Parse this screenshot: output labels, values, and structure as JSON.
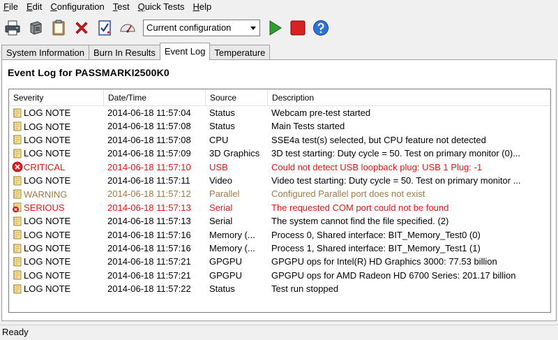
{
  "menu": [
    {
      "label": "File",
      "mnemonic": "F",
      "rest": "ile"
    },
    {
      "label": "Edit",
      "mnemonic": "E",
      "rest": "dit"
    },
    {
      "label": "Configuration",
      "mnemonic": "C",
      "rest": "onfiguration"
    },
    {
      "label": "Test",
      "mnemonic": "T",
      "rest": "est"
    },
    {
      "label": "Quick Tests",
      "mnemonic": "Q",
      "rest": "uick Tests"
    },
    {
      "label": "Help",
      "mnemonic": "H",
      "rest": "elp"
    }
  ],
  "toolbar": {
    "buttons": [
      {
        "icon": "printer-icon"
      },
      {
        "icon": "device-icon"
      },
      {
        "icon": "clipboard-icon"
      },
      {
        "icon": "delete-x-icon"
      },
      {
        "icon": "checklist-icon"
      },
      {
        "icon": "speedometer-icon"
      }
    ],
    "config_select_value": "Current configuration",
    "run_icon": "play-icon",
    "stop_icon": "stop-icon",
    "help_icon": "help-icon"
  },
  "tabs": [
    {
      "label": "System Information",
      "active": false
    },
    {
      "label": "Burn In Results",
      "active": false
    },
    {
      "label": "Event Log",
      "active": true
    },
    {
      "label": "Temperature",
      "active": false
    }
  ],
  "panel": {
    "title": "Event Log for PASSMARKI2500K0"
  },
  "log": {
    "columns": [
      "Severity",
      "Date/Time",
      "Source",
      "Description"
    ],
    "severity_colors": {
      "LOG NOTE": "#000000",
      "CRITICAL": "#e81414",
      "WARNING": "#a07a46",
      "SERIOUS": "#e81414"
    },
    "rows": [
      {
        "severity": "LOG NOTE",
        "datetime": "2014-06-18 11:57:04",
        "source": "Status",
        "description": "Webcam pre-test started"
      },
      {
        "severity": "LOG NOTE",
        "datetime": "2014-06-18 11:57:08",
        "source": "Status",
        "description": "Main Tests started"
      },
      {
        "severity": "LOG NOTE",
        "datetime": "2014-06-18 11:57:08",
        "source": "CPU",
        "description": "SSE4a test(s) selected, but CPU feature not detected"
      },
      {
        "severity": "LOG NOTE",
        "datetime": "2014-06-18 11:57:09",
        "source": "3D Graphics",
        "description": "3D test starting: Duty cycle = 50. Test on primary monitor (0)..."
      },
      {
        "severity": "CRITICAL",
        "datetime": "2014-06-18 11:57:10",
        "source": "USB",
        "description": "Could not detect USB loopback plug: USB 1 Plug: -1"
      },
      {
        "severity": "LOG NOTE",
        "datetime": "2014-06-18 11:57:11",
        "source": "Video",
        "description": "Video test starting: Duty cycle = 50. Test on primary monitor ..."
      },
      {
        "severity": "WARNING",
        "datetime": "2014-06-18 11:57:12",
        "source": "Parallel",
        "description": "Configured Parallel port does not exist"
      },
      {
        "severity": "SERIOUS",
        "datetime": "2014-06-18 11:57:13",
        "source": "Serial",
        "description": "The requested COM port could not be found"
      },
      {
        "severity": "LOG NOTE",
        "datetime": "2014-06-18 11:57:13",
        "source": "Serial",
        "description": "The system cannot find the file specified.   (2)"
      },
      {
        "severity": "LOG NOTE",
        "datetime": "2014-06-18 11:57:16",
        "source": "Memory (...",
        "description": "Process 0, Shared interface: BIT_Memory_Test0 (0)"
      },
      {
        "severity": "LOG NOTE",
        "datetime": "2014-06-18 11:57:16",
        "source": "Memory (...",
        "description": "Process 1, Shared interface: BIT_Memory_Test1 (1)"
      },
      {
        "severity": "LOG NOTE",
        "datetime": "2014-06-18 11:57:21",
        "source": "GPGPU",
        "description": "GPGPU ops for Intel(R) HD Graphics 3000: 77.53 billion"
      },
      {
        "severity": "LOG NOTE",
        "datetime": "2014-06-18 11:57:21",
        "source": "GPGPU",
        "description": "GPGPU ops for AMD Radeon HD 6700 Series: 201.17 billion"
      },
      {
        "severity": "LOG NOTE",
        "datetime": "2014-06-18 11:57:22",
        "source": "Status",
        "description": "Test run stopped"
      }
    ]
  },
  "status": {
    "text": "Ready"
  }
}
